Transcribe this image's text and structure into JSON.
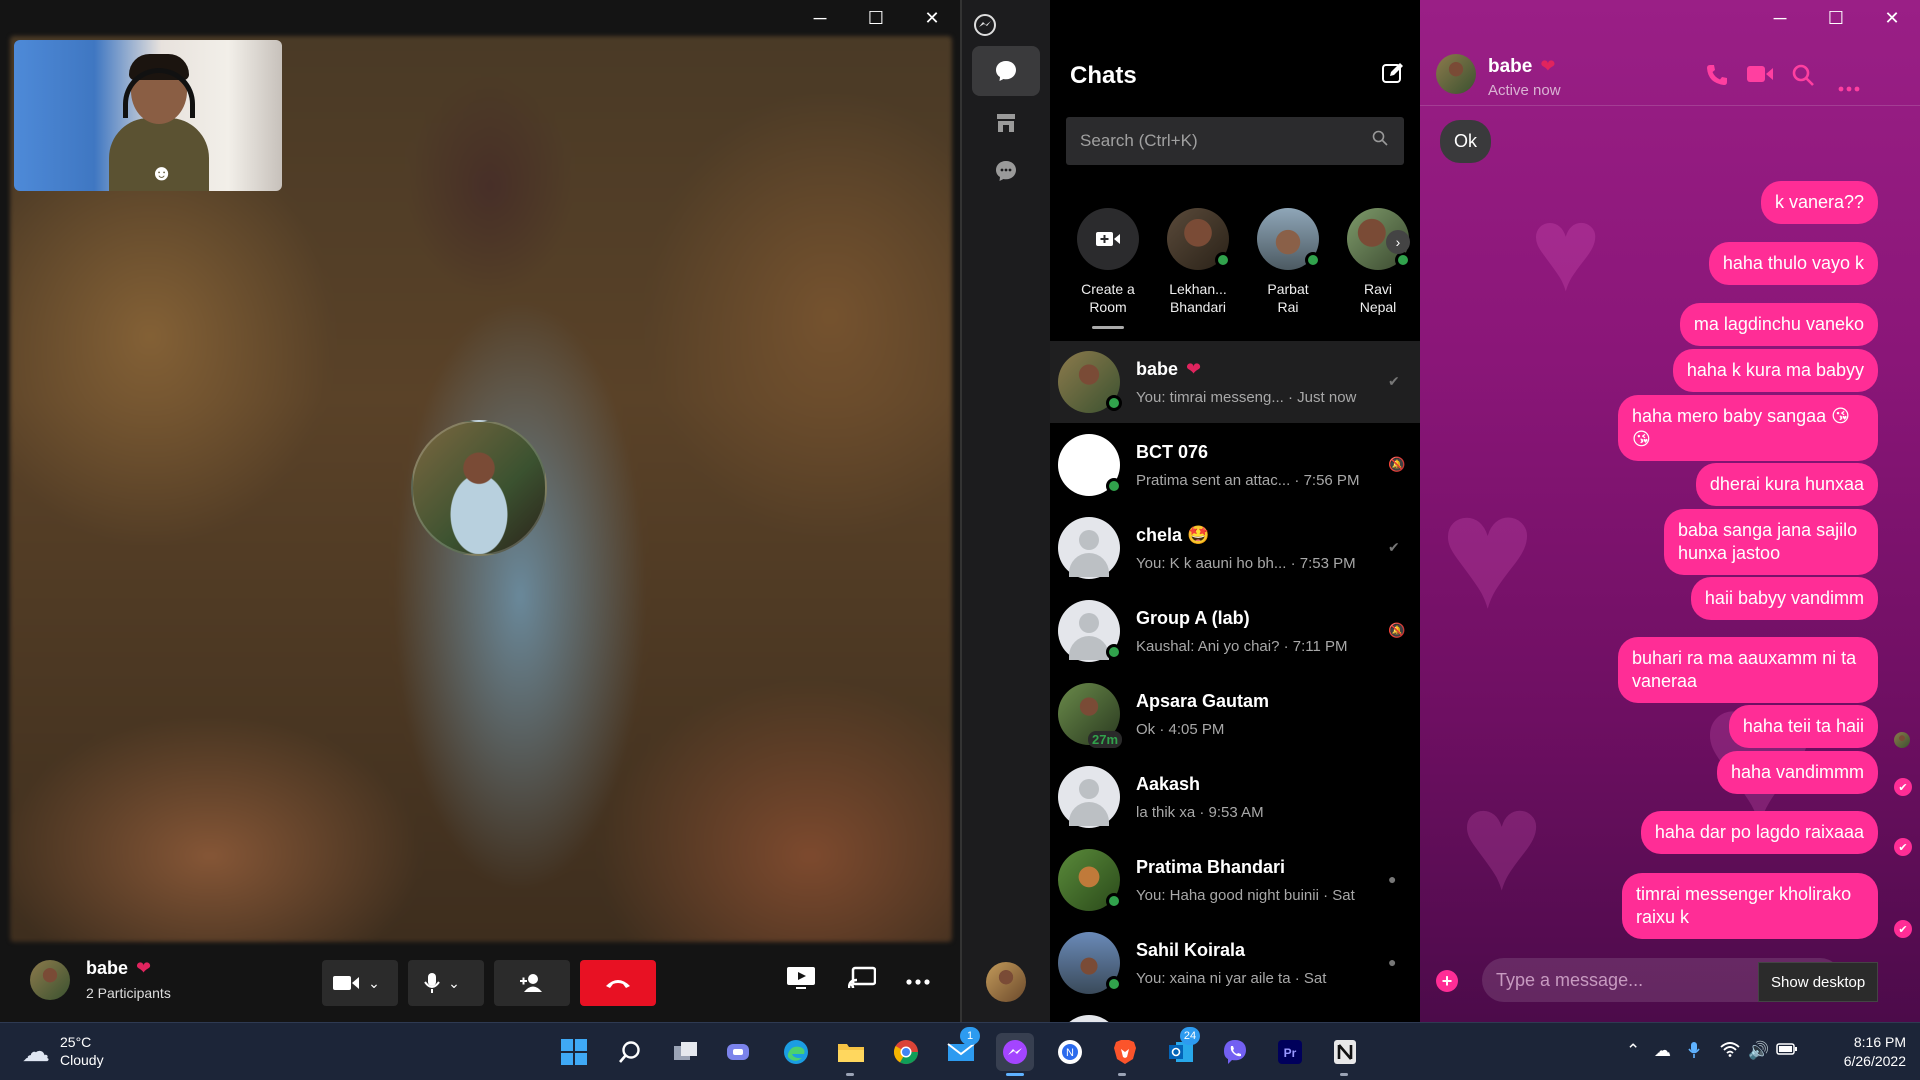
{
  "call": {
    "window_controls": {
      "minimize": "─",
      "maximize": "☐",
      "close": "✕"
    },
    "contact_name": "babe",
    "heart": "❤",
    "participants": "2 Participants",
    "effects_icon": "☻"
  },
  "messenger": {
    "rail": {
      "logo": "messenger-icon",
      "chats_icon": "chat-bubble-icon",
      "marketplace_icon": "store-icon",
      "requests_icon": "message-requests-icon"
    },
    "chats_title": "Chats",
    "search_placeholder": "Search (Ctrl+K)",
    "stories": [
      {
        "label_1": "Create a",
        "label_2": "Room"
      },
      {
        "label_1": "Lekhan...",
        "label_2": "Bhandari"
      },
      {
        "label_1": "Parbat",
        "label_2": "Rai"
      },
      {
        "label_1": "Ravi",
        "label_2": "Nepal"
      }
    ],
    "conversations": [
      {
        "name": "babe",
        "preview": "You: timrai messeng... · Just now",
        "heart": "❤"
      },
      {
        "name": "BCT 076",
        "preview": "Pratima sent an attac... · 7:56 PM"
      },
      {
        "name": "chela",
        "emoji": "🤩",
        "preview": "You: K k aauni ho bh... · 7:53 PM"
      },
      {
        "name": "Group A (lab)",
        "preview": "Kaushal: Ani yo chai? · 7:11 PM"
      },
      {
        "name": "Apsara Gautam",
        "preview": "Ok · 4:05 PM",
        "badge": "27m"
      },
      {
        "name": "Aakash",
        "preview": "la thik xa · 9:53 AM"
      },
      {
        "name": "Pratima Bhandari",
        "preview": "You: Haha good night buinii · Sat"
      },
      {
        "name": "Sahil Koirala",
        "preview": "You: xaina ni yar aile ta · Sat"
      }
    ]
  },
  "conversation": {
    "name": "babe",
    "heart": "❤",
    "status": "Active now",
    "messages": [
      {
        "text": "Ok",
        "from": "them"
      },
      {
        "text": "k vanera??",
        "from": "me"
      },
      {
        "text": "haha thulo vayo k",
        "from": "me"
      },
      {
        "text": "ma lagdinchu vaneko",
        "from": "me"
      },
      {
        "text": "haha k kura ma babyy",
        "from": "me"
      },
      {
        "text": "haha mero baby sangaa 😘 😘",
        "from": "me"
      },
      {
        "text": "dherai kura  hunxaa",
        "from": "me"
      },
      {
        "text": "baba sanga jana sajilo hunxa jastoo",
        "from": "me"
      },
      {
        "text": "haii babyy vandimm",
        "from": "me"
      },
      {
        "text": "buhari ra ma aauxamm ni ta vaneraa",
        "from": "me"
      },
      {
        "text": "haha teii ta haii",
        "from": "me"
      },
      {
        "text": "haha vandimmm",
        "from": "me"
      },
      {
        "text": "haha dar po lagdo raixaaa",
        "from": "me"
      },
      {
        "text": "timrai messenger kholirako raixu k",
        "from": "me"
      }
    ],
    "input_placeholder": "Type a message...",
    "tooltip": "Show desktop"
  },
  "taskbar": {
    "temperature": "25°C",
    "condition": "Cloudy",
    "mail_badge": "1",
    "outlook_badge": "24",
    "time": "8:16 PM",
    "date": "6/26/2022"
  },
  "colors": {
    "accent_pink": "#ff2d96",
    "end_call_red": "#e81123",
    "online_green": "#31a24c"
  }
}
